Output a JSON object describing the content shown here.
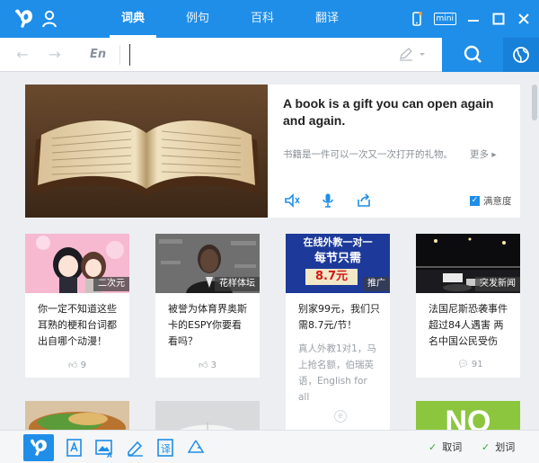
{
  "header": {
    "tabs": [
      {
        "label": "词典",
        "active": true
      },
      {
        "label": "例句",
        "active": false
      },
      {
        "label": "百科",
        "active": false
      },
      {
        "label": "翻译",
        "active": false
      }
    ],
    "mini_label": "mini"
  },
  "search": {
    "lang_label": "En",
    "query": ""
  },
  "hero": {
    "sentence_en": "A book is a gift you can open again and again.",
    "sentence_cn": "书籍是一件可以一次又一次打开的礼物。",
    "more_label": "更多",
    "satisfaction_label": "满意度"
  },
  "cards": [
    {
      "tag": "二次元",
      "title": "你一定不知道这些耳熟的梗和台词都出自哪个动漫！",
      "likes": "9"
    },
    {
      "tag": "花样体坛",
      "title": "被誉为体育界奥斯卡的ESPY你要看看吗？",
      "likes": "3"
    },
    {
      "tag": "推广",
      "banner_line1": "在线外教一对一",
      "banner_line2": "每节只需",
      "banner_price": "8.7元",
      "title": "别家99元，我们只需8.7元/节！",
      "desc": "真人外教1对1，马上抢名额，伯瑞英语，English for all"
    },
    {
      "tag": "突发新闻",
      "title": "法国尼斯恐袭事件超过84人遇害 两名中国公民受伤",
      "comments": "91"
    }
  ],
  "bottom": {
    "toggle1": "取词",
    "toggle2": "划词"
  },
  "colors": {
    "brand_blue": "#1e8ee8",
    "check_green": "#3aaa35"
  }
}
